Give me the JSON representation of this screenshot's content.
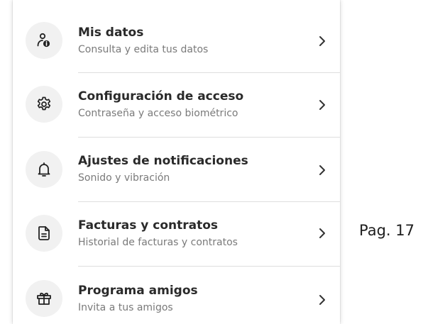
{
  "menu": {
    "items": [
      {
        "title": "Mis datos",
        "subtitle": "Consulta y edita tus datos",
        "icon": "user-info-icon"
      },
      {
        "title": "Configuración de acceso",
        "subtitle": "Contraseña y acceso biométrico",
        "icon": "gear-icon"
      },
      {
        "title": "Ajustes de notificaciones",
        "subtitle": "Sonido y vibración",
        "icon": "bell-icon"
      },
      {
        "title": "Facturas y contratos",
        "subtitle": "Historial de facturas y contratos",
        "icon": "document-icon"
      },
      {
        "title": "Programa amigos",
        "subtitle": "Invita a tus amigos",
        "icon": "gift-icon"
      }
    ]
  },
  "page_label": "Pag. 17",
  "colors": {
    "title": "#2a2a2a",
    "subtitle": "#7a7a7a",
    "icon_background": "#f1f1f1",
    "icon": "#222222",
    "divider": "#dedede"
  }
}
